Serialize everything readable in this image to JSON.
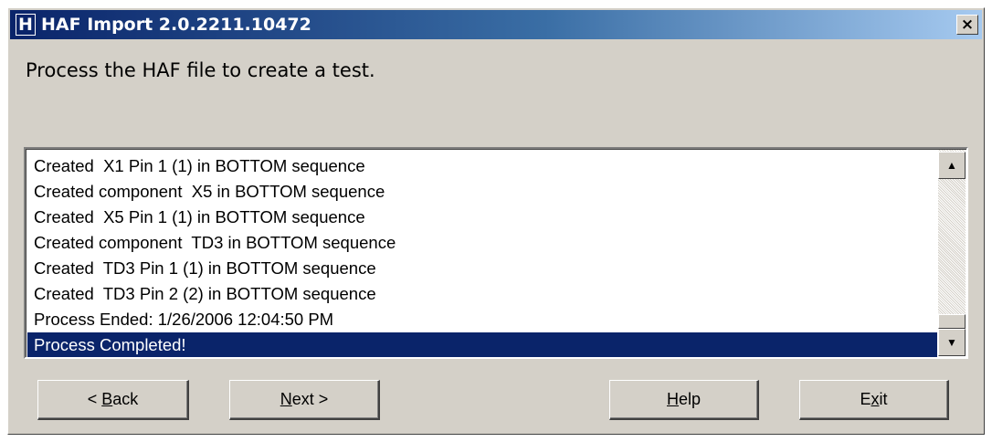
{
  "window": {
    "title": "HAF Import 2.0.2211.10472",
    "icon_letter": "H",
    "close_glyph": "×"
  },
  "instruction": "Process the HAF file to create a test.",
  "log": {
    "items": [
      "Created  X1 Pin 1 (1) in BOTTOM sequence",
      "Created component  X5 in BOTTOM sequence",
      "Created  X5 Pin 1 (1) in BOTTOM sequence",
      "Created component  TD3 in BOTTOM sequence",
      "Created  TD3 Pin 1 (1) in BOTTOM sequence",
      "Created  TD3 Pin 2 (2) in BOTTOM sequence",
      "Process Ended: 1/26/2006 12:04:50 PM",
      "Process Completed!"
    ],
    "selected_index": 7
  },
  "buttons": {
    "back": {
      "pre": "< ",
      "mnemonic": "B",
      "post": "ack"
    },
    "next": {
      "pre": "",
      "mnemonic": "N",
      "post": "ext >"
    },
    "help": {
      "pre": "",
      "mnemonic": "H",
      "post": "elp"
    },
    "exit": {
      "pre": "E",
      "mnemonic": "x",
      "post": "it"
    }
  },
  "colors": {
    "dialog_bg": "#d4d0c8",
    "titlebar_start": "#0a246a",
    "titlebar_end": "#a6caf0",
    "selection": "#0a246a"
  }
}
